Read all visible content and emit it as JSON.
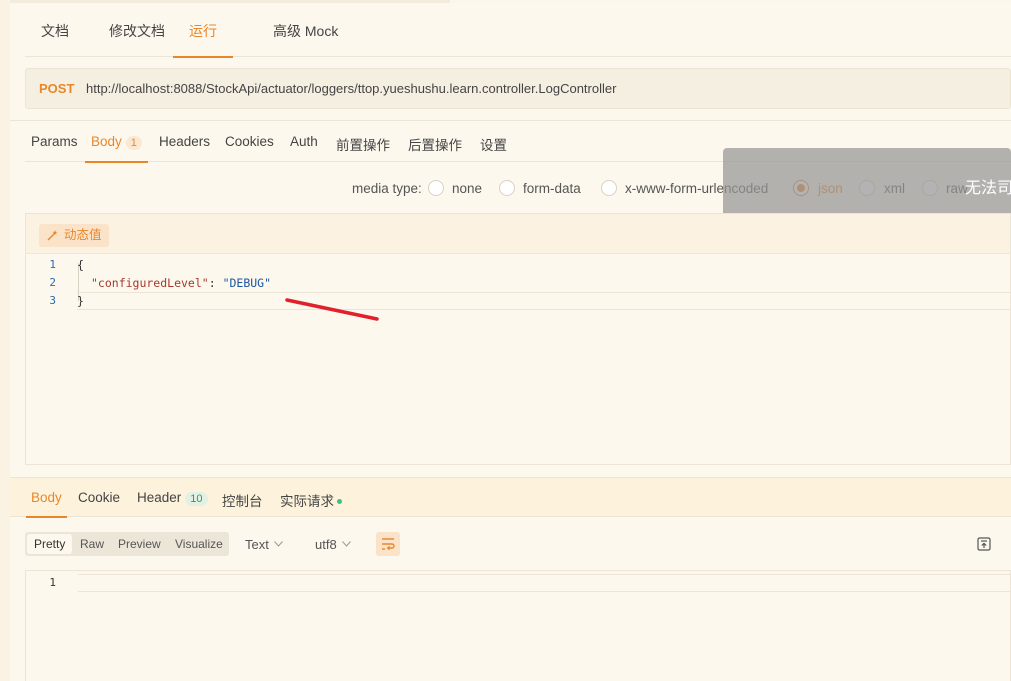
{
  "top_tabs": [
    {
      "label": "文档"
    },
    {
      "label": "修改文档"
    },
    {
      "label": "运行"
    },
    {
      "label": "高级 Mock"
    }
  ],
  "request": {
    "method": "POST",
    "url": "http://localhost:8088/StockApi/actuator/loggers/ttop.yueshushu.learn.controller.LogController"
  },
  "req_tabs": [
    {
      "label": "Params"
    },
    {
      "label": "Body",
      "badge": "1"
    },
    {
      "label": "Headers"
    },
    {
      "label": "Cookies"
    },
    {
      "label": "Auth"
    },
    {
      "label": "前置操作"
    },
    {
      "label": "后置操作"
    },
    {
      "label": "设置"
    }
  ],
  "media_type": {
    "label": "media type:",
    "options": [
      "none",
      "form-data",
      "x-www-form-urlencoded",
      "json",
      "xml",
      "raw"
    ],
    "selected": "json"
  },
  "toast": {
    "text": "无法司"
  },
  "editor": {
    "dynamic_button": "动态值",
    "lines": [
      {
        "no": "1",
        "text": "{"
      },
      {
        "no": "2",
        "key": "\"configuredLevel\"",
        "sep": ": ",
        "value": "\"DEBUG\""
      },
      {
        "no": "3",
        "text": "}"
      }
    ]
  },
  "response": {
    "tabs": [
      {
        "label": "Body"
      },
      {
        "label": "Cookie"
      },
      {
        "label": "Header",
        "badge": "10"
      },
      {
        "label": "控制台"
      },
      {
        "label": "实际请求"
      }
    ],
    "view_modes": [
      "Pretty",
      "Raw",
      "Preview",
      "Visualize"
    ],
    "active_view": "Pretty",
    "format": "Text",
    "encoding": "utf8",
    "lines": [
      {
        "no": "1"
      }
    ]
  },
  "colors": {
    "accent": "#e8872a",
    "background": "#fdf8ee",
    "annotation_red": "#e0202a"
  }
}
